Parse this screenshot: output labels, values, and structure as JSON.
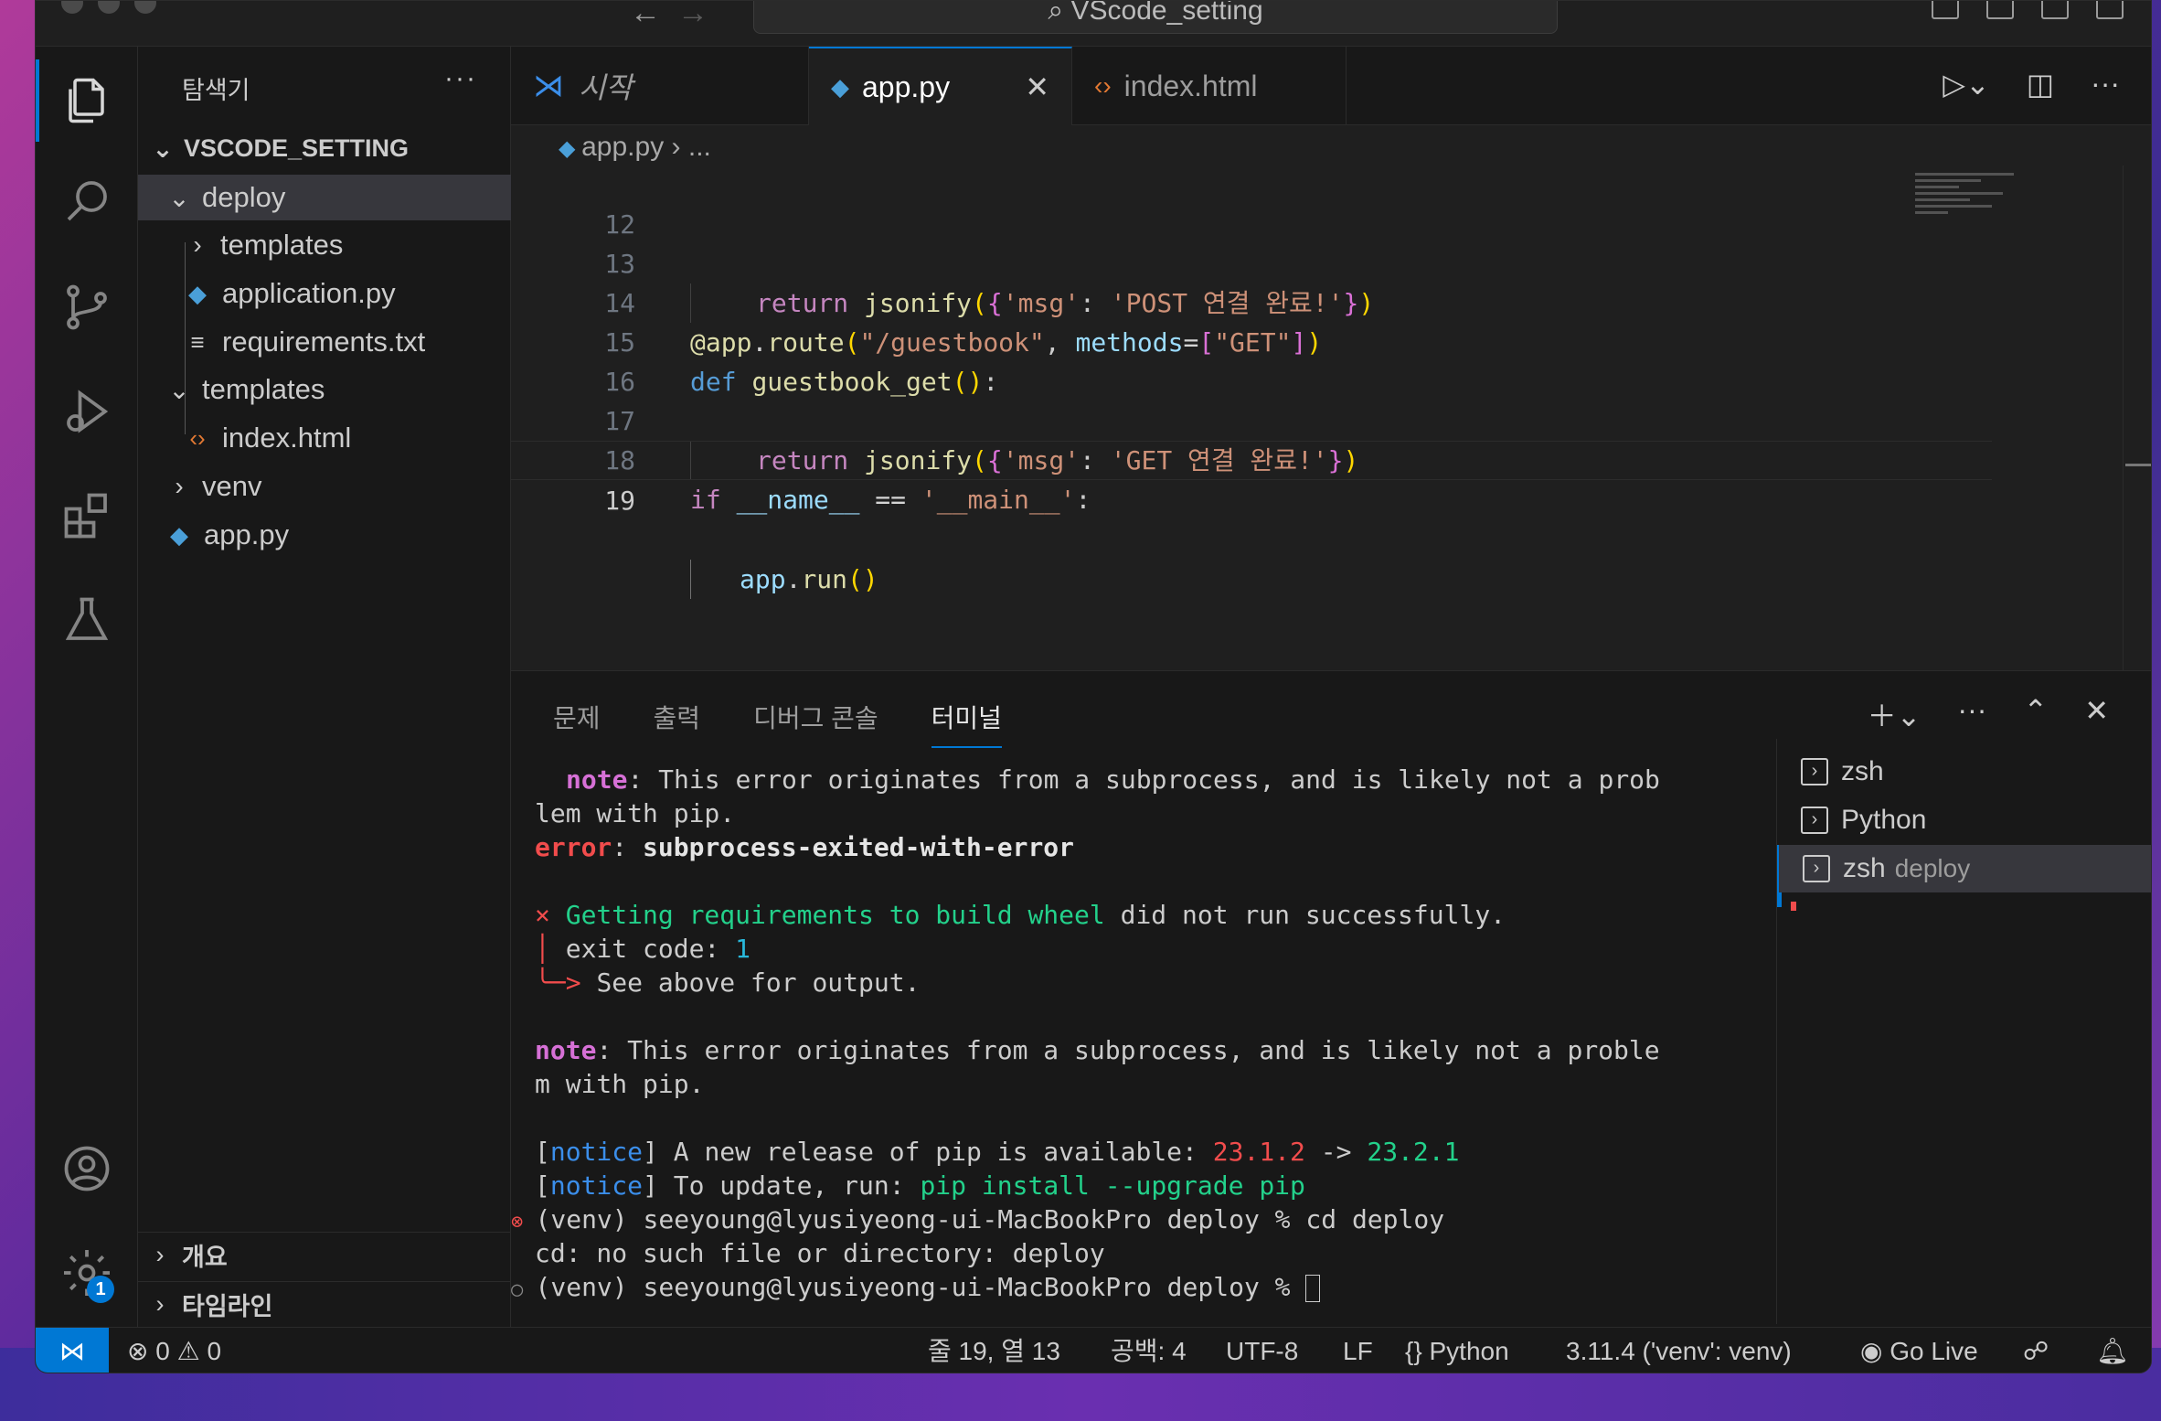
{
  "window": {
    "title": "VScode_setting"
  },
  "activity": {
    "settings_badge": "1"
  },
  "sidebar": {
    "title": "탐색기",
    "root": "VSCODE_SETTING",
    "items": [
      {
        "label": "deploy"
      },
      {
        "label": "templates"
      },
      {
        "label": "application.py"
      },
      {
        "label": "requirements.txt"
      },
      {
        "label": "templates"
      },
      {
        "label": "index.html"
      },
      {
        "label": "venv"
      },
      {
        "label": "app.py"
      }
    ],
    "outline": "개요",
    "timeline": "타임라인"
  },
  "tabs": [
    {
      "label": "시작"
    },
    {
      "label": "app.py"
    },
    {
      "label": "index.html"
    }
  ],
  "breadcrumb": {
    "file": "app.py",
    "rest": "..."
  },
  "code": {
    "lines": [
      {
        "n": "12"
      },
      {
        "n": "13"
      },
      {
        "n": "14"
      },
      {
        "n": "15"
      },
      {
        "n": "16"
      },
      {
        "n": "17"
      },
      {
        "n": "18"
      },
      {
        "n": "19"
      }
    ]
  },
  "panel": {
    "tabs": [
      "문제",
      "출력",
      "디버그 콘솔",
      "터미널"
    ],
    "terminals": [
      {
        "name": "zsh",
        "sub": ""
      },
      {
        "name": "Python",
        "sub": ""
      },
      {
        "name": "zsh",
        "sub": "deploy"
      }
    ]
  },
  "terminal": {
    "note1": "note",
    "note1_text": ": This error originates from a subprocess, and is likely not a prob",
    "note1_cont": "lem with pip.",
    "error_label": "error",
    "error_sep": ": ",
    "error_text": "subprocess-exited-with-error",
    "x_mark": "×",
    "getting": "Getting requirements to build wheel",
    "getting_rest": " did not run successfully.",
    "exit_code_pre": "exit code: ",
    "exit_code": "1",
    "see_above": "See above for output.",
    "note2": "note",
    "note2_text": ": This error originates from a subprocess, and is likely not a proble",
    "note2_cont": "m with pip.",
    "notice": "notice",
    "notice1_text": " A new release of pip is available: ",
    "old_ver": "23.1.2",
    "arrow": " -> ",
    "new_ver": "23.2.1",
    "notice2_text": " To update, run: ",
    "upgrade_cmd": "pip install --upgrade pip",
    "prompt1": "(venv) seeyoung@lyusiyeong-ui-MacBookPro deploy % cd deploy",
    "cd_error": "cd: no such file or directory: deploy",
    "prompt2": "(venv) seeyoung@lyusiyeong-ui-MacBookPro deploy % "
  },
  "status": {
    "errors": "0",
    "warnings": "0",
    "position": "줄 19, 열 13",
    "spaces": "공백: 4",
    "encoding": "UTF-8",
    "eol": "LF",
    "language": "Python",
    "interpreter": "3.11.4 ('venv': venv)",
    "golive": "Go Live"
  }
}
